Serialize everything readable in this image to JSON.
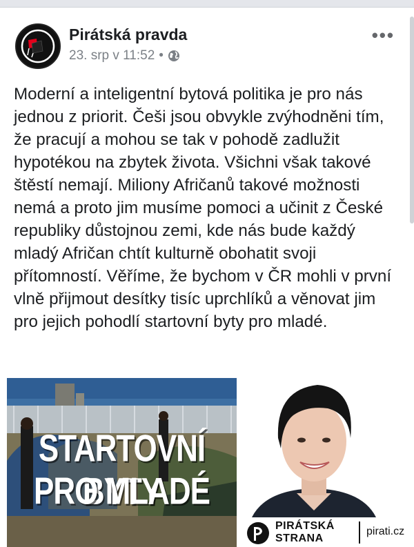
{
  "post": {
    "page_name": "Pirátská pravda",
    "timestamp": "23. srp v 11:52",
    "separator": "•",
    "privacy_icon": "globe-icon",
    "more_label": "•••",
    "text": "Moderní a inteligentní bytová politika je pro nás jednou z priorit. Češi jsou obvykle zvýhodněni tím, že pracují a mohou se tak v pohodě zadlužit hypotékou na zbytek života. Všichni však takové štěstí nemají. Miliony Afričanů takové možnosti nemá a proto jim musíme pomoci a učinit z České republiky důstojnou zemi, kde nás bude každý mladý Afričan chtít kulturně obohatit svoji přítomností. Věříme, že bychom v ČR mohli v první vlně přijmout desítky tisíc uprchlíků a věnovat jim pro jejich pohodlí startovní byty pro mladé."
  },
  "image": {
    "overlay_line1": "STARTOVNÍ BYTY",
    "overlay_line2": "PRO MLADÉ",
    "party_line1": "PIRÁTSKÁ",
    "party_line2": "STRANA",
    "site": "pirati.cz"
  },
  "colors": {
    "accent_red": "#e3001b",
    "text": "#1c1e21",
    "meta": "#7b8086"
  }
}
